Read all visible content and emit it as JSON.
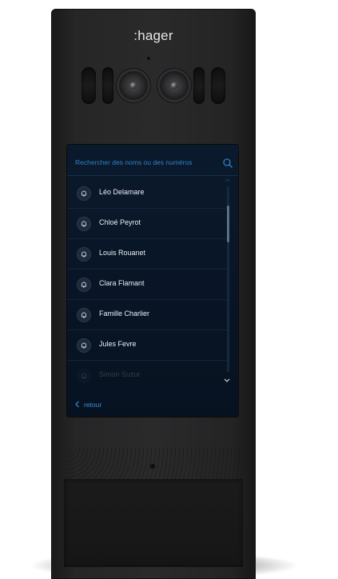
{
  "brand": {
    "logo_text": ":hager"
  },
  "search": {
    "placeholder": "Rechercher des noms ou des numéros"
  },
  "contacts": [
    {
      "name": "Léo Delamare"
    },
    {
      "name": "Chloé Peyrot"
    },
    {
      "name": "Louis Rouanet"
    },
    {
      "name": "Clara Flamant"
    },
    {
      "name": "Famille Charlier"
    },
    {
      "name": "Jules Fevre"
    },
    {
      "name": "Simon Suzur"
    }
  ],
  "navigation": {
    "back_label": "retour"
  },
  "icons": {
    "search": "search-icon",
    "contact": "bell-icon",
    "scroll_up": "chevron-up-icon",
    "scroll_down": "chevron-down-icon",
    "back": "chevron-left-icon"
  },
  "colors": {
    "screen_background": "#0a1a2c",
    "accent_blue": "#2f80c8",
    "text_primary": "#e8eef5",
    "panel": "#2a2a2b"
  }
}
